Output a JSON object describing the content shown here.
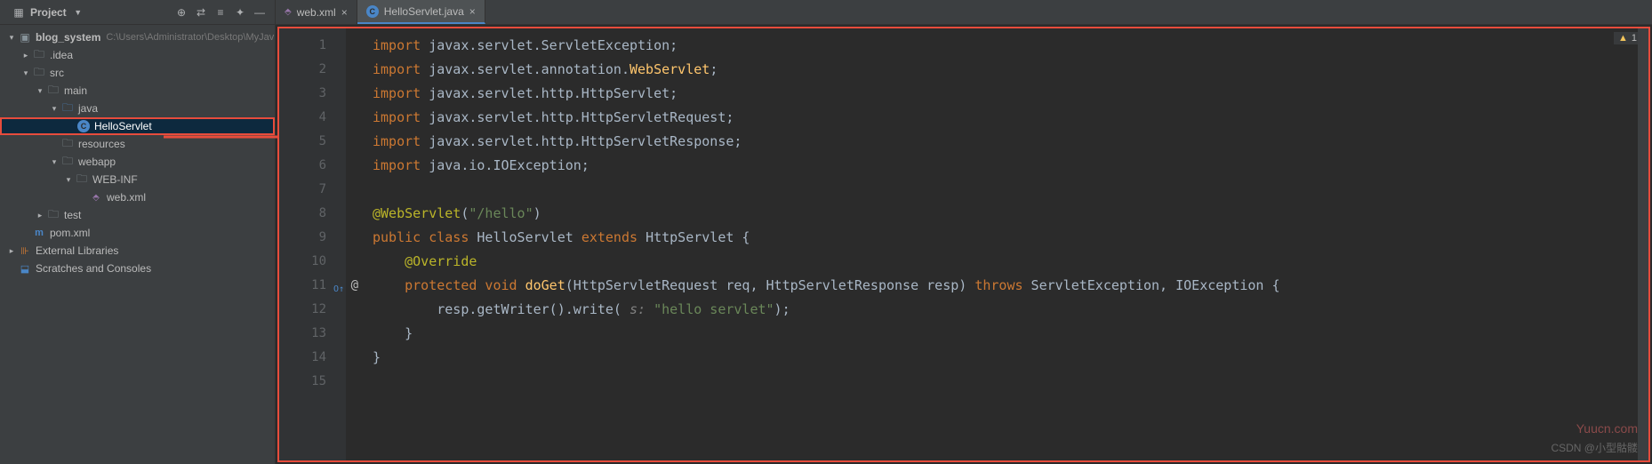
{
  "project_panel": {
    "title": "Project",
    "toolbar_icons": [
      "target-icon",
      "refresh-icon",
      "collapse-icon",
      "divide-icon",
      "gear-icon",
      "hide-icon"
    ]
  },
  "tree": {
    "root": {
      "label": "blog_system",
      "path": "C:\\Users\\Administrator\\Desktop\\MyJav"
    },
    "idea": ".idea",
    "src": "src",
    "main": "main",
    "java": "java",
    "hello_servlet": "HelloServlet",
    "resources": "resources",
    "webapp": "webapp",
    "webinf": "WEB-INF",
    "webxml": "web.xml",
    "test": "test",
    "pom": "pom.xml",
    "ext_libs": "External Libraries",
    "scratches": "Scratches and Consoles"
  },
  "tabs": [
    {
      "label": "web.xml",
      "icon": "xml-file-icon",
      "active": false
    },
    {
      "label": "HelloServlet.java",
      "icon": "class-file-icon",
      "active": true
    }
  ],
  "warnings": {
    "count": "1"
  },
  "code": {
    "lines": [
      {
        "n": "1",
        "tokens": [
          {
            "t": "import ",
            "c": "kw"
          },
          {
            "t": "javax.servlet.ServletException;",
            "c": "type"
          }
        ]
      },
      {
        "n": "2",
        "tokens": [
          {
            "t": "import ",
            "c": "kw"
          },
          {
            "t": "javax.servlet.annotation.",
            "c": "type"
          },
          {
            "t": "WebServlet",
            "c": "fn"
          },
          {
            "t": ";",
            "c": "type"
          }
        ]
      },
      {
        "n": "3",
        "tokens": [
          {
            "t": "import ",
            "c": "kw"
          },
          {
            "t": "javax.servlet.http.HttpServlet;",
            "c": "type"
          }
        ]
      },
      {
        "n": "4",
        "tokens": [
          {
            "t": "import ",
            "c": "kw"
          },
          {
            "t": "javax.servlet.http.HttpServletRequest;",
            "c": "type"
          }
        ]
      },
      {
        "n": "5",
        "tokens": [
          {
            "t": "import ",
            "c": "kw"
          },
          {
            "t": "javax.servlet.http.HttpServletResponse;",
            "c": "type"
          }
        ]
      },
      {
        "n": "6",
        "tokens": [
          {
            "t": "import ",
            "c": "kw"
          },
          {
            "t": "java.io.IOException;",
            "c": "type"
          }
        ]
      },
      {
        "n": "7",
        "tokens": []
      },
      {
        "n": "8",
        "tokens": [
          {
            "t": "@WebServlet",
            "c": "ann"
          },
          {
            "t": "(",
            "c": "type"
          },
          {
            "t": "\"/hello\"",
            "c": "str"
          },
          {
            "t": ")",
            "c": "type"
          }
        ]
      },
      {
        "n": "9",
        "tokens": [
          {
            "t": "public class ",
            "c": "kw"
          },
          {
            "t": "HelloServlet ",
            "c": "type"
          },
          {
            "t": "extends ",
            "c": "kw"
          },
          {
            "t": "HttpServlet {",
            "c": "type"
          }
        ]
      },
      {
        "n": "10",
        "tokens": [
          {
            "t": "    ",
            "c": "type"
          },
          {
            "t": "@Override",
            "c": "ann"
          }
        ]
      },
      {
        "n": "11",
        "override": true,
        "tokens": [
          {
            "t": "    ",
            "c": "type"
          },
          {
            "t": "protected void ",
            "c": "kw"
          },
          {
            "t": "doGet",
            "c": "fn"
          },
          {
            "t": "(HttpServletRequest req, HttpServletResponse resp) ",
            "c": "type"
          },
          {
            "t": "throws ",
            "c": "kw"
          },
          {
            "t": "ServletException, IOException {",
            "c": "type"
          }
        ]
      },
      {
        "n": "12",
        "tokens": [
          {
            "t": "        resp.getWriter().write( ",
            "c": "type"
          },
          {
            "t": "s: ",
            "c": "param"
          },
          {
            "t": "\"hello servlet\"",
            "c": "str"
          },
          {
            "t": ");",
            "c": "type"
          }
        ]
      },
      {
        "n": "13",
        "tokens": [
          {
            "t": "    }",
            "c": "type"
          }
        ]
      },
      {
        "n": "14",
        "tokens": [
          {
            "t": "}",
            "c": "type"
          }
        ]
      },
      {
        "n": "15",
        "tokens": []
      }
    ]
  },
  "watermark1": "Yuucn.com",
  "watermark2": "CSDN @小型骷髅"
}
